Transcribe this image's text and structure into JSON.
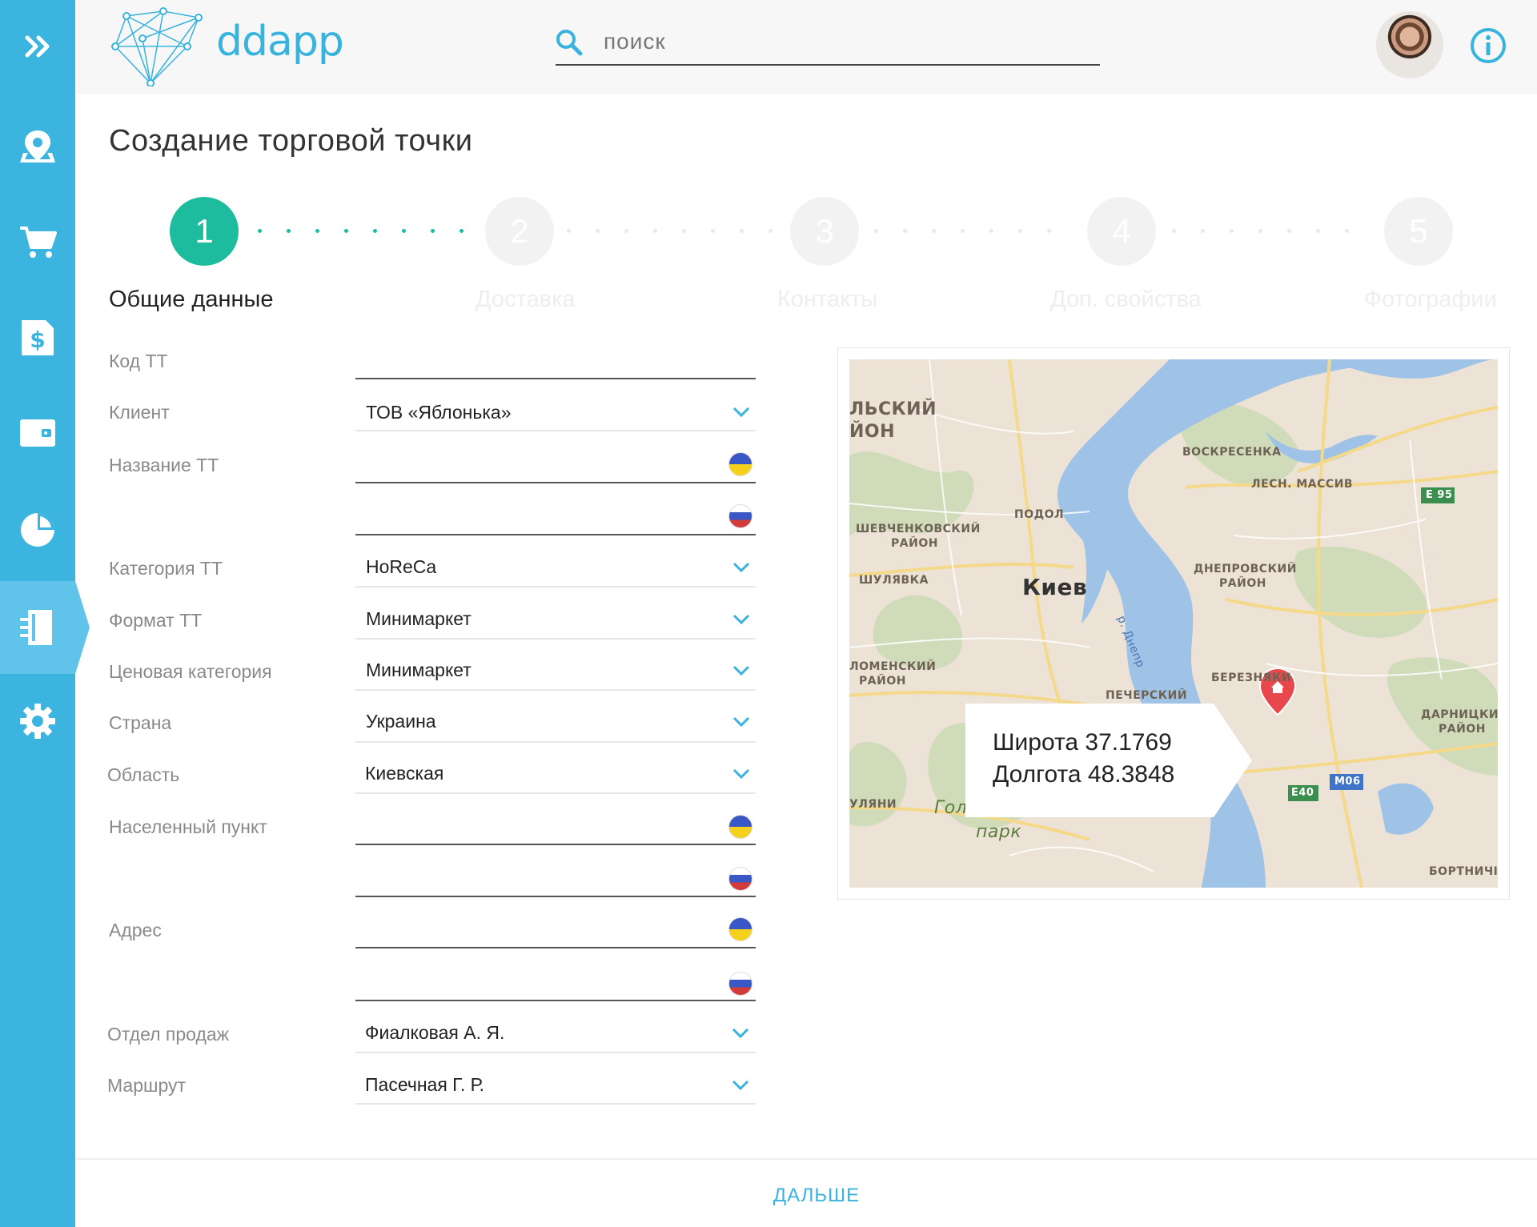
{
  "app": {
    "logo_text": "ddapp"
  },
  "search": {
    "placeholder": "поиск"
  },
  "page": {
    "title": "Создание торговой точки"
  },
  "stepper": {
    "active_step": 1,
    "steps": [
      {
        "number": "1",
        "label": "Общие данные"
      },
      {
        "number": "2",
        "label": "Доставка"
      },
      {
        "number": "3",
        "label": "Контакты"
      },
      {
        "number": "4",
        "label": "Доп. свойства"
      },
      {
        "number": "5",
        "label": "Фотографии"
      }
    ]
  },
  "form": {
    "code": {
      "label": "Код ТТ",
      "value": ""
    },
    "client": {
      "label": "Клиент",
      "value": "ТОВ «Яблонька»"
    },
    "name": {
      "label": "Название ТТ",
      "value_ua": "",
      "value_ru": ""
    },
    "category": {
      "label": "Категория ТТ",
      "value": "HoReCa"
    },
    "format": {
      "label": "Формат ТТ",
      "value": "Минимаркет"
    },
    "price_category": {
      "label": "Ценовая категория",
      "value": "Минимаркет"
    },
    "country": {
      "label": "Страна",
      "value": "Украина"
    },
    "region": {
      "label": "Область",
      "value": "Киевская"
    },
    "locality": {
      "label": "Населенный пункт",
      "value_ua": "",
      "value_ru": ""
    },
    "address": {
      "label": "Адрес",
      "value_ua": "",
      "value_ru": ""
    },
    "sales_dept": {
      "label": "Отдел продаж",
      "value": "Фиалковая А. Я."
    },
    "route": {
      "label": "Маршрут",
      "value": "Пасечная Г. Р."
    }
  },
  "map": {
    "latitude_text": "Широта 37.1769",
    "longitude_text": "Долгота 48.3848",
    "labels": {
      "city": "Киев",
      "district_top": "ЛЬСКИЙ",
      "district_top2": "ЙОН",
      "voskresenka": "ВОСКРЕСЕНКА",
      "les_massiv": "ЛЕСН. МАССИВ",
      "podol": "ПОДОЛ",
      "shevchenko1": "ШЕВЧЕНКОВСКИЙ",
      "shevchenko2": "РАЙОН",
      "shulyavka": "ШУЛЯВКА",
      "dnepr1": "ДНЕПРОВСКИЙ",
      "dnepr2": "РАЙОН",
      "river": "р. Днепр",
      "solomen1": "ЛОМЕНСКИЙ",
      "solomen2": "РАЙОН",
      "berezn": "БЕРЕЗНЯКИ",
      "pechersk": "ПЕЧЕРСКИЙ",
      "darn1": "ДАРНИЦКИ",
      "darn2": "РАЙОН",
      "vulytsi": "УЛЯНИ",
      "gol": "Гол",
      "park": "парк",
      "bortn": "БОРТНИЧІ",
      "e95": "E 95",
      "e40": "E40",
      "m06": "М06"
    }
  },
  "footer": {
    "next_label": "ДАЛЬШЕ"
  },
  "colors": {
    "sidebar": "#3cb4e0",
    "accent": "#1ebc9e",
    "link": "#38b3de"
  },
  "icons": {
    "sidebar": [
      "expand-icon",
      "map-pin-icon",
      "cart-icon",
      "invoice-icon",
      "wallet-icon",
      "pie-chart-icon",
      "outlet-icon",
      "settings-icon"
    ],
    "header": [
      "search-icon",
      "info-icon"
    ]
  }
}
